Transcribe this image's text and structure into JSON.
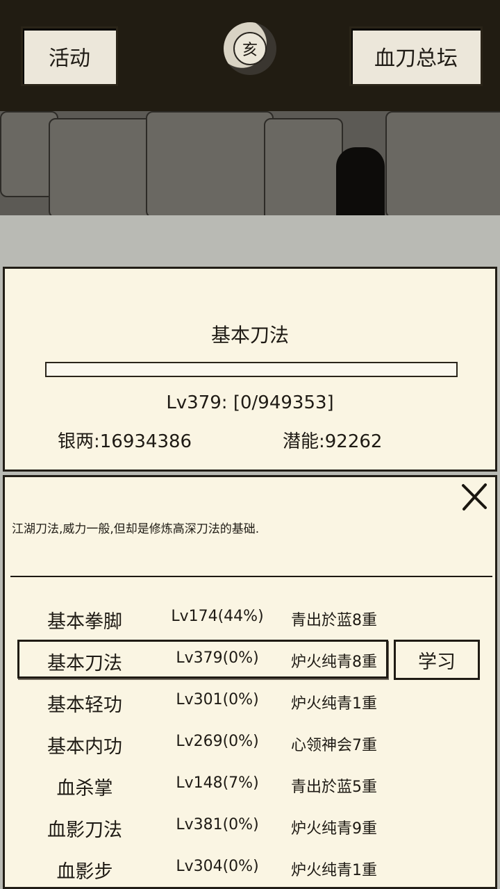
{
  "topbar": {
    "activity_label": "活动",
    "emblem_glyph": "亥",
    "hall_label": "血刀总坛"
  },
  "info": {
    "skill_name": "基本刀法",
    "progress_fraction": 0,
    "level_text": "Lv379:  [0/949353]",
    "silver_text": "银两:16934386",
    "potential_text": "潜能:92262"
  },
  "detail": {
    "description": "江湖刀法,威力一般,但却是修炼高深刀法的基础.",
    "learn_label": "学习",
    "skills": [
      {
        "name": "基本拳脚",
        "level": "Lv174(44%)",
        "realm": "青出於蓝8重"
      },
      {
        "name": "基本刀法",
        "level": "Lv379(0%)",
        "realm": "炉火纯青8重"
      },
      {
        "name": "基本轻功",
        "level": "Lv301(0%)",
        "realm": "炉火纯青1重"
      },
      {
        "name": "基本内功",
        "level": "Lv269(0%)",
        "realm": "心领神会7重"
      },
      {
        "name": "血杀掌",
        "level": "Lv148(7%)",
        "realm": "青出於蓝5重"
      },
      {
        "name": "血影刀法",
        "level": "Lv381(0%)",
        "realm": "炉火纯青9重"
      },
      {
        "name": "血影步",
        "level": "Lv304(0%)",
        "realm": "炉火纯青1重"
      }
    ]
  },
  "colors": {
    "topbar_bg": "#211c12",
    "panel_bg": "#faf5e3",
    "border": "#211d16"
  },
  "icons": {
    "close": "close-icon",
    "emblem": "moon-emblem-icon"
  }
}
